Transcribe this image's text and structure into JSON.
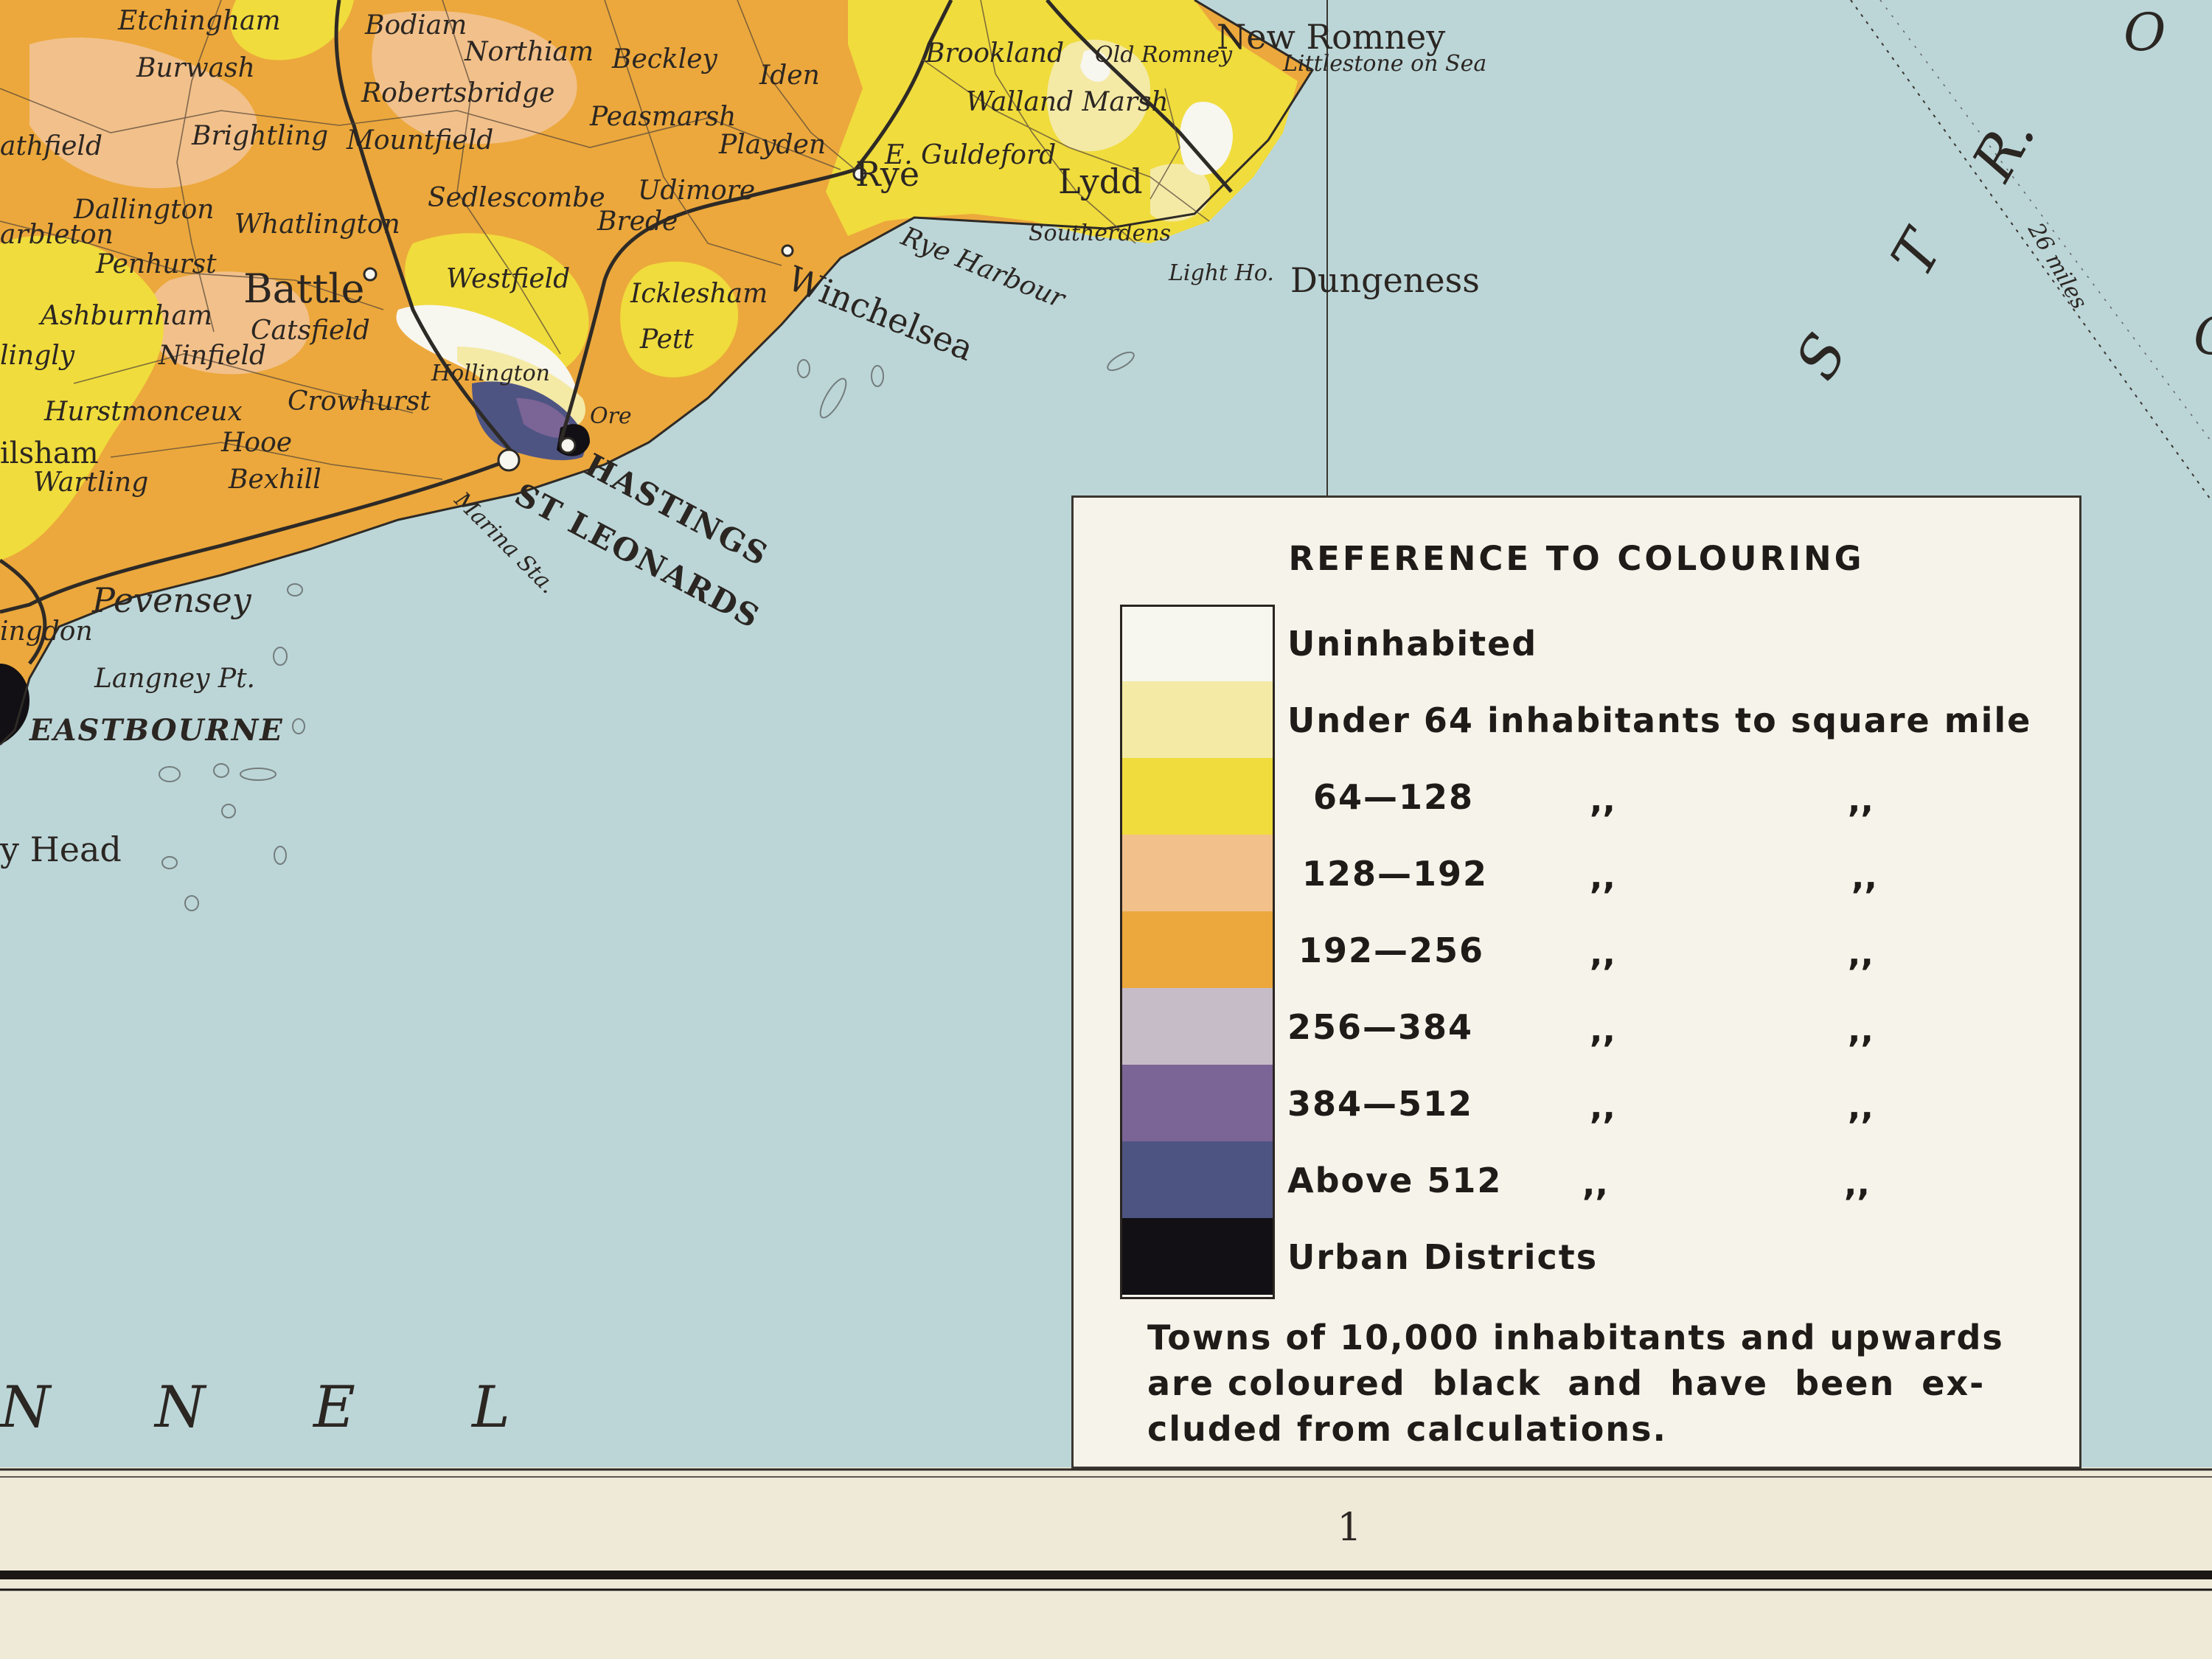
{
  "places": [
    {
      "id": "etchingham",
      "label": "Etchingham"
    },
    {
      "id": "bodiam",
      "label": "Bodiam"
    },
    {
      "id": "northiam",
      "label": "Northiam"
    },
    {
      "id": "beckley",
      "label": "Beckley"
    },
    {
      "id": "burwash",
      "label": "Burwash"
    },
    {
      "id": "robertsbridge",
      "label": "Robertsbridge"
    },
    {
      "id": "iden",
      "label": "Iden"
    },
    {
      "id": "peasmarsh",
      "label": "Peasmarsh"
    },
    {
      "id": "brookland",
      "label": "Brookland"
    },
    {
      "id": "old-romney",
      "label": "Old Romney"
    },
    {
      "id": "new-romney",
      "label": "New Romney"
    },
    {
      "id": "littlestone",
      "label": "Littlestone on Sea"
    },
    {
      "id": "walland-marsh",
      "label": "Walland Marsh"
    },
    {
      "id": "e-guldeford",
      "label": "E. Guldeford"
    },
    {
      "id": "heathfield",
      "label": "athfield"
    },
    {
      "id": "brightling",
      "label": "Brightling"
    },
    {
      "id": "mountfield",
      "label": "Mountfield"
    },
    {
      "id": "playden",
      "label": "Playden"
    },
    {
      "id": "rye",
      "label": "Rye"
    },
    {
      "id": "lydd",
      "label": "Lydd"
    },
    {
      "id": "sedlescombe",
      "label": "Sedlescombe"
    },
    {
      "id": "udimore",
      "label": "Udimore"
    },
    {
      "id": "dallington",
      "label": "Dallington"
    },
    {
      "id": "whatlington",
      "label": "Whatlington"
    },
    {
      "id": "brede",
      "label": "Brede"
    },
    {
      "id": "warbleton",
      "label": "arbleton"
    },
    {
      "id": "penhurst",
      "label": "Penhurst"
    },
    {
      "id": "southerdens",
      "label": "Southerdens"
    },
    {
      "id": "rye-harbour",
      "label": "Rye Harbour"
    },
    {
      "id": "light-ho",
      "label": "Light Ho."
    },
    {
      "id": "dungeness",
      "label": "Dungeness"
    },
    {
      "id": "battle",
      "label": "Battle"
    },
    {
      "id": "westfield",
      "label": "Westfield"
    },
    {
      "id": "icklesham",
      "label": "Icklesham"
    },
    {
      "id": "winchelsea",
      "label": "Winchelsea"
    },
    {
      "id": "ashburnham",
      "label": "Ashburnham"
    },
    {
      "id": "catsfield",
      "label": "Catsfield"
    },
    {
      "id": "pett",
      "label": "Pett"
    },
    {
      "id": "hellingly",
      "label": "lingly"
    },
    {
      "id": "ninfield",
      "label": "Ninfield"
    },
    {
      "id": "hollington",
      "label": "Hollington"
    },
    {
      "id": "crowhurst",
      "label": "Crowhurst"
    },
    {
      "id": "ore",
      "label": "Ore"
    },
    {
      "id": "herstmonceux",
      "label": "Hurstmonceux"
    },
    {
      "id": "hailsham",
      "label": "ilsham"
    },
    {
      "id": "hooe",
      "label": "Hooe"
    },
    {
      "id": "wartling",
      "label": "Wartling"
    },
    {
      "id": "bexhill",
      "label": "Bexhill"
    },
    {
      "id": "hastings",
      "label": "HASTINGS"
    },
    {
      "id": "st-leonards",
      "label": "ST LEONARDS"
    },
    {
      "id": "marina-sta",
      "label": "Marina Sta."
    },
    {
      "id": "pevensey",
      "label": "Pevensey"
    },
    {
      "id": "willingdon",
      "label": "ingdon"
    },
    {
      "id": "langney-pt",
      "label": "Langney Pt."
    },
    {
      "id": "eastbourne",
      "label": "EASTBOURNE"
    },
    {
      "id": "beachy-head",
      "label": "y Head"
    }
  ],
  "sea_labels": {
    "channel": [
      "N",
      "N",
      "E",
      "L"
    ],
    "strait": [
      "S",
      "T",
      "R."
    ],
    "edge_top": "O",
    "edge_right": "C"
  },
  "scale_note": "26 miles",
  "legend": {
    "title": "REFERENCE TO COLOURING",
    "ditto": ",,",
    "items": [
      {
        "label": "Uninhabited",
        "color": "#f7f6ef"
      },
      {
        "label": "Under 64 inhabitants to square mile",
        "color": "#f4eaa6"
      },
      {
        "label": "64—128",
        "color": "#f0dc3c"
      },
      {
        "label": "128—192",
        "color": "#f2c08a"
      },
      {
        "label": "192—256",
        "color": "#eca83c"
      },
      {
        "label": "256—384",
        "color": "#c6bcc8"
      },
      {
        "label": "384—512",
        "color": "#7b6496"
      },
      {
        "label": "Above 512",
        "color": "#4e5482"
      },
      {
        "label": "Urban Districts",
        "color": "#121014"
      }
    ],
    "note": [
      "Towns of 10,000 inhabitants and upwards",
      "are coloured  black  and  have  been  ex-",
      "cluded from calculations."
    ]
  },
  "page_number": "1",
  "colors": {
    "sea": "#bcd6d8",
    "paper": "#efe9d8",
    "rail": "#2e2a26"
  }
}
